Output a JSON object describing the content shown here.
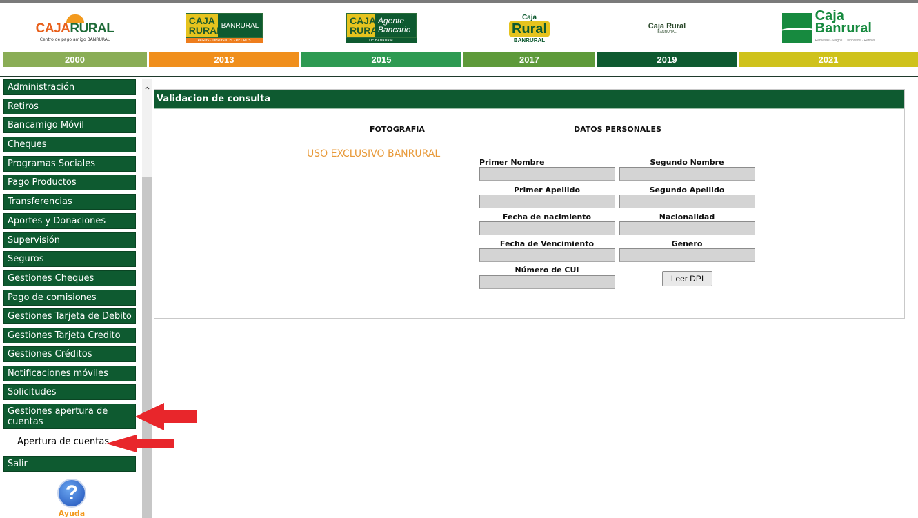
{
  "header": {
    "logos": [
      {
        "id": "2000",
        "brand": "CAJA",
        "brand2": "RURAL",
        "tagline": "Centro de pago amigo BANRURAL"
      },
      {
        "id": "2013",
        "brand": "CAJA RURAL",
        "partner": "BANRURAL",
        "tagline": "PAGOS · DEPÓSITOS · RETIROS"
      },
      {
        "id": "2015",
        "brand": "CAJA RURAL",
        "partner": "Agente Bancario",
        "tagline": "DE BANRURAL"
      },
      {
        "id": "2017",
        "brand_top": "Caja",
        "brand": "Rural",
        "partner": "BANRURAL"
      },
      {
        "id": "2019",
        "brand": "Caja Rural",
        "partner": "BANRURAL"
      },
      {
        "id": "2021",
        "brand": "Caja",
        "brand2": "Banrural",
        "tagline": "Remesas · Pagos · Depósitos · Retiros"
      }
    ],
    "years": [
      {
        "label": "2000",
        "color": "#8aad56"
      },
      {
        "label": "2013",
        "color": "#f08f1c"
      },
      {
        "label": "2015",
        "color": "#2e9a52"
      },
      {
        "label": "2017",
        "color": "#5e9a3a"
      },
      {
        "label": "2019",
        "color": "#0e5a30"
      },
      {
        "label": "2021",
        "color": "#cfc21b"
      }
    ]
  },
  "sidebar": {
    "items": [
      "Administración",
      "Retiros",
      "Bancamigo Móvil",
      "Cheques",
      "Programas Sociales",
      "Pago Productos",
      "Transferencias",
      "Aportes y Donaciones",
      "Supervisión",
      "Seguros",
      "Gestiones Cheques",
      "Pago de comisiones",
      "Gestiones Tarjeta de Debito",
      "Gestiones Tarjeta Credito",
      "Gestiones Créditos",
      "Notificaciones móviles",
      "Solicitudes",
      "Gestiones apertura de cuentas"
    ],
    "subitem": "Apertura de cuentas",
    "exit": "Salir",
    "help_label": "Ayuda",
    "help_glyph": "?"
  },
  "panel": {
    "title": "Validacion de consulta",
    "photo_heading": "FOTOGRAFIA",
    "personal_heading": "DATOS PERSONALES",
    "photo_placeholder": "USO EXCLUSIVO BANRURAL",
    "fields": {
      "primer_nombre": {
        "label": "Primer Nombre",
        "value": ""
      },
      "segundo_nombre": {
        "label": "Segundo Nombre",
        "value": ""
      },
      "primer_apellido": {
        "label": "Primer Apellido",
        "value": ""
      },
      "segundo_apellido": {
        "label": "Segundo Apellido",
        "value": ""
      },
      "fecha_nacimiento": {
        "label": "Fecha de nacimiento",
        "value": ""
      },
      "nacionalidad": {
        "label": "Nacionalidad",
        "value": ""
      },
      "fecha_vencimiento": {
        "label": "Fecha de Vencimiento",
        "value": ""
      },
      "genero": {
        "label": "Genero",
        "value": ""
      },
      "cui": {
        "label": "Número de CUI",
        "value": ""
      }
    },
    "read_button": "Leer DPI"
  },
  "colors": {
    "menu_green": "#0e5a30",
    "arrow_red": "#e8262b",
    "placeholder_orange": "#e89a3a"
  }
}
